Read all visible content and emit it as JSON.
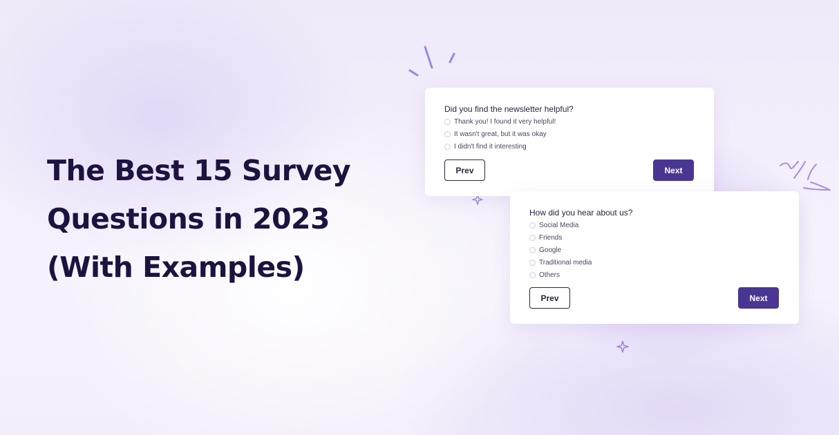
{
  "headline": {
    "lines": [
      "The Best 15 Survey",
      "Questions in 2023",
      "(With Examples)"
    ]
  },
  "survey_cards": [
    {
      "question": "Did you find the newsletter helpful?",
      "options": [
        "Thank you! I found it very helpful!",
        "It wasn't great, but it was okay",
        "I didn't find it interesting"
      ],
      "prev_label": "Prev",
      "next_label": "Next"
    },
    {
      "question": "How did you hear about us?",
      "options": [
        "Social Media",
        "Friends",
        "Google",
        "Traditional media",
        "Others"
      ],
      "prev_label": "Prev",
      "next_label": "Next"
    }
  ],
  "colors": {
    "headline": "#1c1340",
    "button_primary": "#4b3592",
    "accent_decoration": "#8f7ad6"
  },
  "icons": [
    "sparkle-icon",
    "burst-lines-icon",
    "scribble-icon"
  ]
}
